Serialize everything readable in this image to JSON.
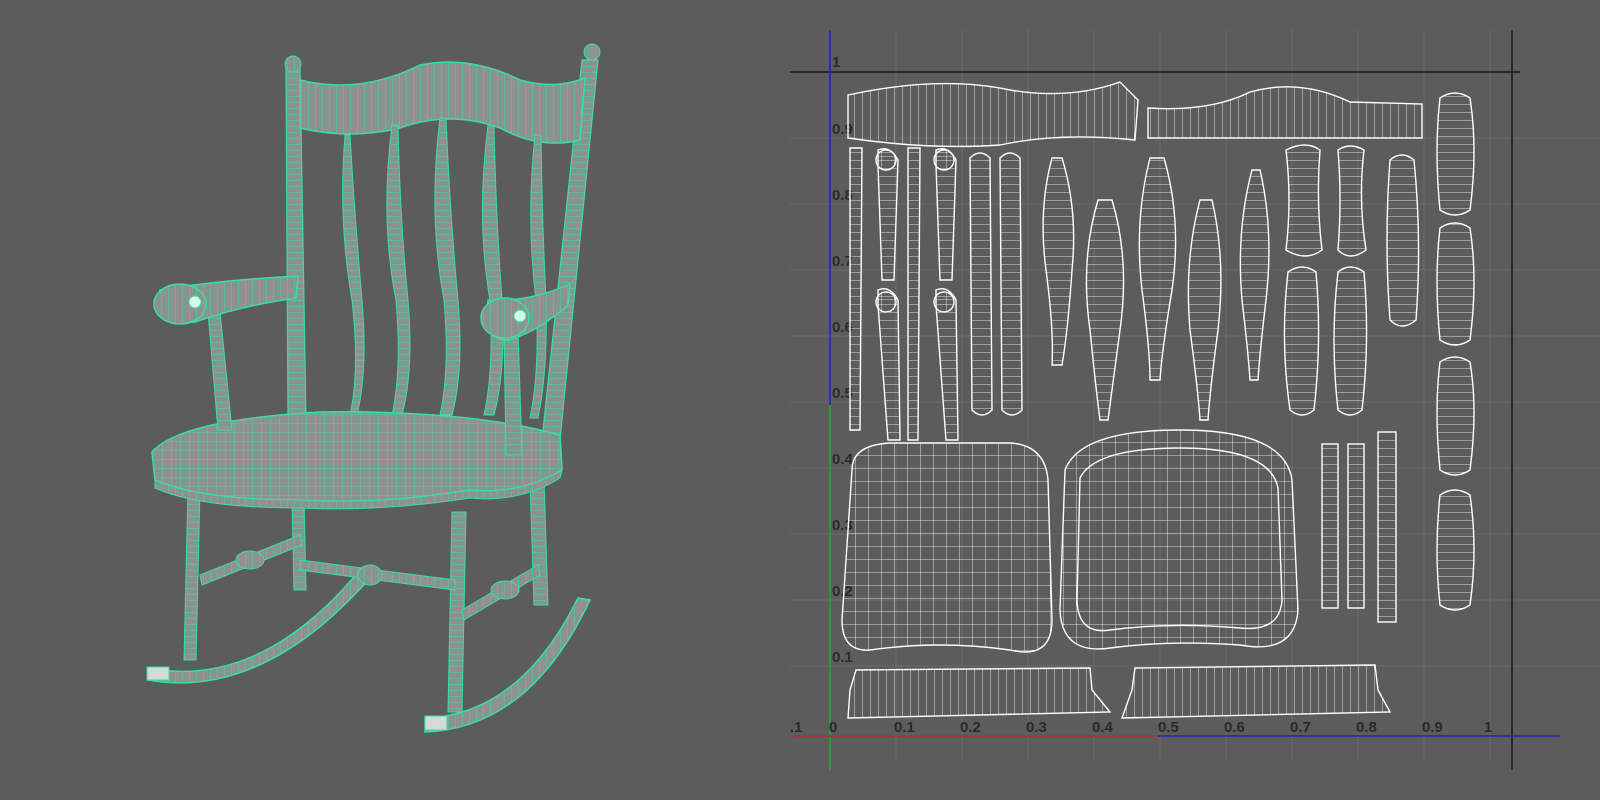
{
  "colors": {
    "background": "#5c5c5c",
    "wireframe_selected": "#38e0a0",
    "mesh_shade": "#8e9490",
    "uv_shell": "#ffffff",
    "uv_grid": "#6a6a6a",
    "axis_u": "#b03030",
    "axis_v": "#30a040",
    "axis_blue": "#2020c0",
    "axis_frame": "#1a1a1a"
  },
  "viewport": {
    "object": "rocking-chair-mesh",
    "display": "wireframe-on-shaded"
  },
  "uv_editor": {
    "u_ticks": [
      "-.1",
      "0",
      "0.1",
      "0.2",
      "0.3",
      "0.4",
      "0.5",
      "0.6",
      "0.7",
      "0.8",
      "0.9",
      "1"
    ],
    "v_ticks": [
      "1",
      "0.9",
      "0.8",
      "0.7",
      "0.6",
      "0.5",
      "0.4",
      "0.3",
      "0.2",
      "0.1"
    ]
  }
}
